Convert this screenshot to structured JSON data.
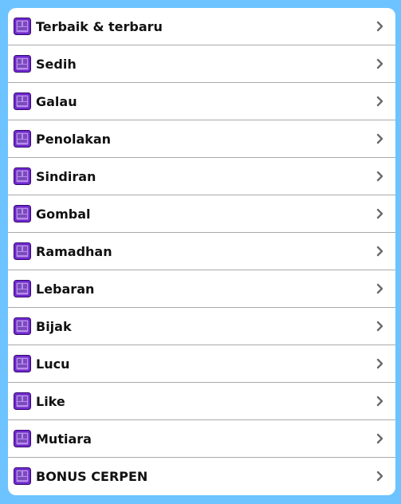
{
  "colors": {
    "background": "#6cc3ff",
    "panel": "#ffffff",
    "divider": "#a9a9a9",
    "icon_purple": "#7b2be0",
    "chevron": "#6b6b6b"
  },
  "list": {
    "item_icon": "book-category-icon",
    "chevron_icon": "chevron-right-icon",
    "items": [
      {
        "label": "Terbaik & terbaru"
      },
      {
        "label": "Sedih"
      },
      {
        "label": "Galau"
      },
      {
        "label": "Penolakan"
      },
      {
        "label": "Sindiran"
      },
      {
        "label": "Gombal"
      },
      {
        "label": "Ramadhan"
      },
      {
        "label": "Lebaran"
      },
      {
        "label": "Bijak"
      },
      {
        "label": "Lucu"
      },
      {
        "label": "Like"
      },
      {
        "label": "Mutiara"
      },
      {
        "label": "BONUS CERPEN"
      }
    ]
  }
}
